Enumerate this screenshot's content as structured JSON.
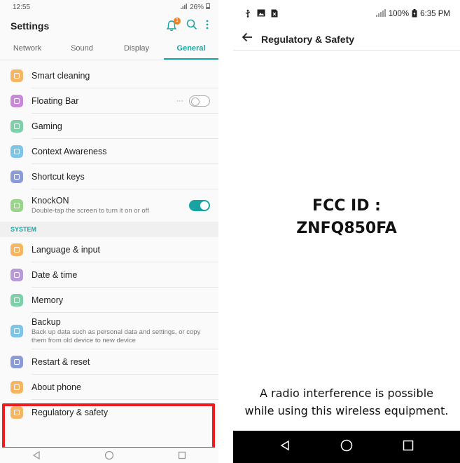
{
  "left": {
    "status": {
      "time": "12:55",
      "battery": "26%"
    },
    "header": {
      "title": "Settings",
      "notification_count": "1"
    },
    "tabs": [
      {
        "label": "Network"
      },
      {
        "label": "Sound"
      },
      {
        "label": "Display"
      },
      {
        "label": "General"
      }
    ],
    "items": [
      {
        "label": "Smart cleaning"
      },
      {
        "label": "Floating Bar"
      },
      {
        "label": "Gaming"
      },
      {
        "label": "Context Awareness"
      },
      {
        "label": "Shortcut keys"
      },
      {
        "label": "KnockON",
        "sub": "Double-tap the screen to turn it on or off"
      }
    ],
    "section": "SYSTEM",
    "system_items": [
      {
        "label": "Language & input"
      },
      {
        "label": "Date & time"
      },
      {
        "label": "Memory"
      },
      {
        "label": "Backup",
        "sub": "Back up data such as personal data and settings, or copy them from old device to new device"
      },
      {
        "label": "Restart & reset"
      },
      {
        "label": "About phone"
      },
      {
        "label": "Regulatory & safety"
      }
    ]
  },
  "right": {
    "status": {
      "battery": "100%",
      "time": "6:35 PM"
    },
    "title": "Regulatory & Safety",
    "fcc_line1": "FCC ID :",
    "fcc_line2": "ZNFQ850FA",
    "notice_line1": "A radio interference is possible",
    "notice_line2": "while using this wireless equipment."
  },
  "colors": {
    "accent": "#1aa3a3",
    "highlight": "#ee1c1c",
    "badge": "#f2821e"
  }
}
